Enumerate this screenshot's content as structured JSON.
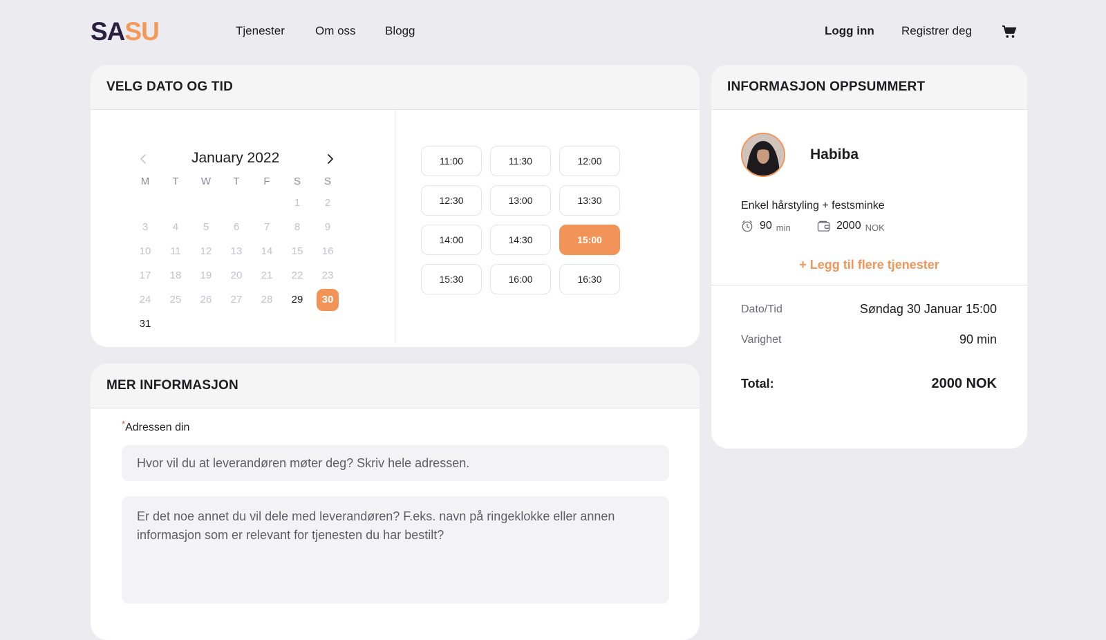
{
  "header": {
    "logo_part1": "SA",
    "logo_part2": "SU",
    "nav": [
      "Tjenester",
      "Om oss",
      "Blogg"
    ],
    "login": "Logg inn",
    "register": "Registrer deg",
    "cart_icon": "cart-icon"
  },
  "colors": {
    "accent": "#f29457",
    "logo_dark": "#2b1f3f",
    "background": "#ecebf0"
  },
  "datetime": {
    "title": "VELG DATO OG TID",
    "month": "January 2022",
    "weekdays": [
      "M",
      "T",
      "W",
      "T",
      "F",
      "S",
      "S"
    ],
    "weeks": [
      [
        "",
        "",
        "",
        "",
        "",
        "1",
        "2"
      ],
      [
        "3",
        "4",
        "5",
        "6",
        "7",
        "8",
        "9"
      ],
      [
        "10",
        "11",
        "12",
        "13",
        "14",
        "15",
        "16"
      ],
      [
        "17",
        "18",
        "19",
        "20",
        "21",
        "22",
        "23"
      ],
      [
        "24",
        "25",
        "26",
        "27",
        "28",
        "29",
        "30"
      ],
      [
        "31",
        "",
        "",
        "",
        "",
        "",
        ""
      ]
    ],
    "available_days": [
      "29",
      "30",
      "31"
    ],
    "selected_day": "30",
    "slots": [
      "11:00",
      "11:30",
      "12:00",
      "12:30",
      "13:00",
      "13:30",
      "14:00",
      "14:30",
      "15:00",
      "15:30",
      "16:00",
      "16:30"
    ],
    "selected_slot": "15:00"
  },
  "more_info": {
    "title": "MER INFORMASJON",
    "required_mark": "*",
    "address_label": "Adressen din",
    "address_placeholder": "Hvor vil du at leverandøren møter deg? Skriv hele adressen.",
    "notes_placeholder": "Er det noe annet du vil dele med leverandøren? F.eks. navn på ringeklokke eller annen informasjon som er relevant for tjenesten du har bestilt?"
  },
  "summary": {
    "title": "INFORMASJON OPPSUMMERT",
    "provider": "Habiba",
    "service": "Enkel hårstyling + festsminke",
    "duration_value": "90",
    "duration_unit": "min",
    "price_value": "2000",
    "price_unit": "NOK",
    "add_more": "+ Legg til flere tjenester",
    "date_label": "Dato/Tid",
    "date_value": "Søndag 30 Januar 15:00",
    "duration_label": "Varighet",
    "duration_full": "90 min",
    "total_label": "Total:",
    "total_value": "2000 NOK"
  }
}
